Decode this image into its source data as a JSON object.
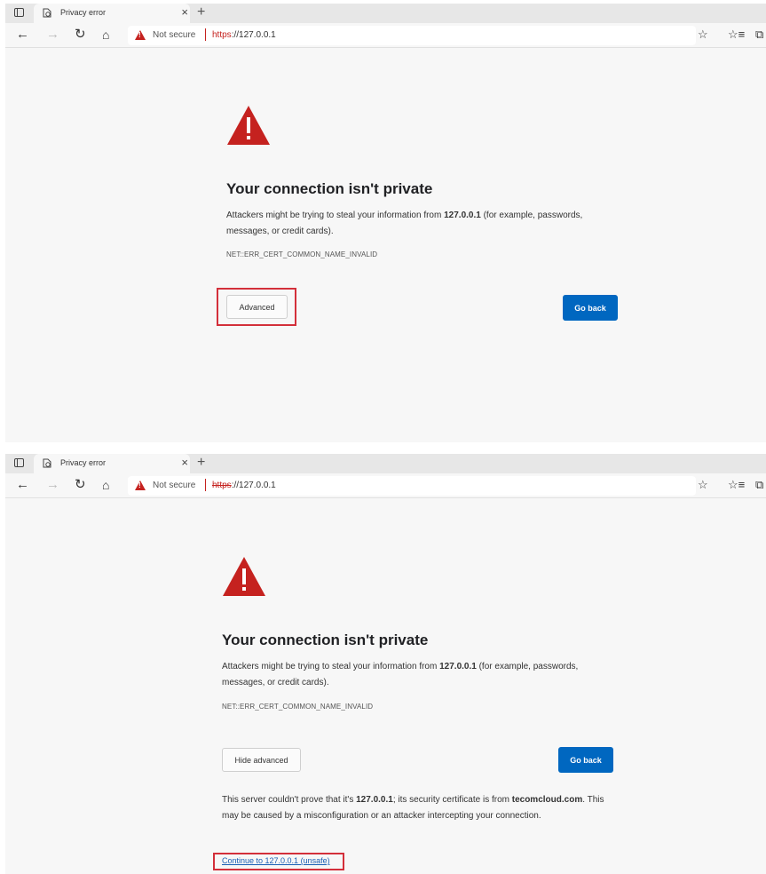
{
  "screens": [
    {
      "tab": {
        "title": "Privacy error",
        "close": "×"
      },
      "new_tab": "+",
      "address": {
        "security_label": "Not secure",
        "url_scheme": "https",
        "url_rest": "://127.0.0.1"
      },
      "heading": "Your connection isn't private",
      "message": {
        "before": "Attackers might be trying to steal your information from ",
        "host": "127.0.0.1",
        "after": " (for example, passwords, messages, or credit cards)."
      },
      "error_code": "NET::ERR_CERT_COMMON_NAME_INVALID",
      "advanced_button": "Advanced",
      "go_back_button": "Go back"
    },
    {
      "tab": {
        "title": "Privacy error",
        "close": "×"
      },
      "new_tab": "+",
      "address": {
        "security_label": "Not secure",
        "url_scheme": "https",
        "url_rest": "://127.0.0.1"
      },
      "heading": "Your connection isn't private",
      "message": {
        "before": "Attackers might be trying to steal your information from ",
        "host": "127.0.0.1",
        "after": " (for example, passwords, messages, or credit cards)."
      },
      "error_code": "NET::ERR_CERT_COMMON_NAME_INVALID",
      "hide_advanced_button": "Hide advanced",
      "go_back_button": "Go back",
      "details": {
        "p1": "This server couldn't prove that it's ",
        "host": "127.0.0.1",
        "p2": "; its security certificate is from ",
        "issuer": "tecomcloud.com",
        "p3": ". This may be caused by a misconfiguration or an attacker intercepting your connection."
      },
      "proceed_link": "Continue to 127.0.0.1 (unsafe)"
    }
  ],
  "colors": {
    "danger": "#c5221f",
    "primary": "#0067c0",
    "highlight": "#d32f3a"
  },
  "icons": [
    "workspaces-icon",
    "privacy-error-favicon",
    "back-icon",
    "forward-icon",
    "reload-icon",
    "home-icon",
    "not-secure-warning-icon",
    "add-favorite-icon",
    "favorites-icon",
    "collections-icon",
    "warning-triangle-icon"
  ]
}
